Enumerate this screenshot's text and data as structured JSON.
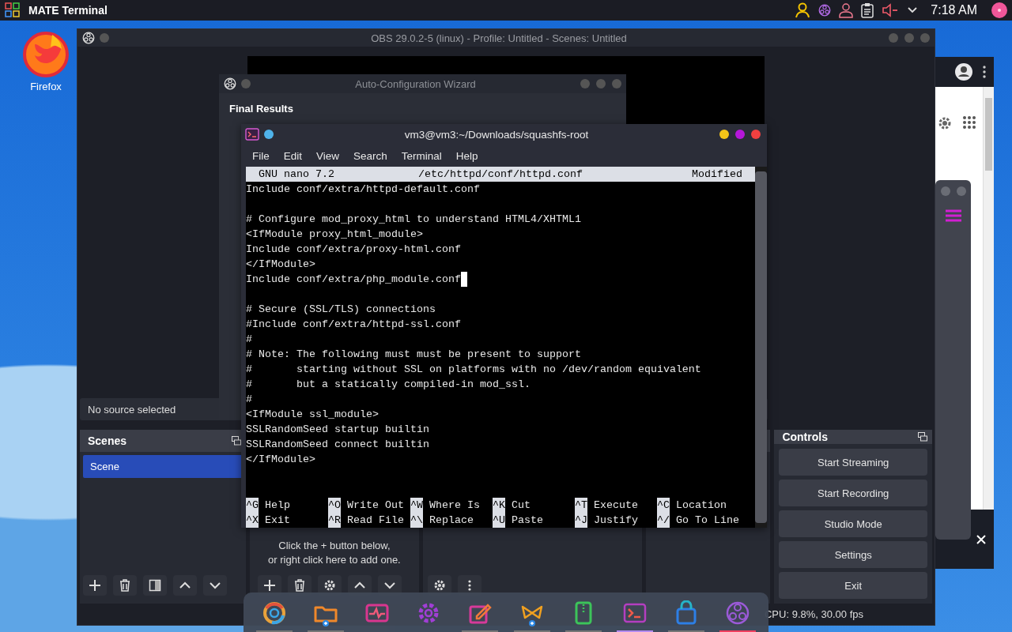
{
  "top_panel": {
    "app_title": "MATE Terminal",
    "clock": "7:18 AM"
  },
  "desktop_icons": [
    {
      "label": "Firefox"
    }
  ],
  "obs_window": {
    "title": "OBS 29.0.2-5 (linux) - Profile: Untitled - Scenes: Untitled",
    "context_bar": "No source selected",
    "scenes": {
      "title": "Scenes",
      "items": [
        {
          "label": "Scene",
          "selected": true
        }
      ]
    },
    "sources": {
      "empty_hint": [
        "Click the + button below,",
        "or right click here to add one."
      ]
    },
    "controls": {
      "title": "Controls",
      "buttons": [
        "Start Streaming",
        "Start Recording",
        "Studio Mode",
        "Settings",
        "Exit"
      ]
    },
    "status": "CPU: 9.8%, 30.00 fps"
  },
  "wizard_window": {
    "title": "Auto-Configuration Wizard",
    "heading": "Final Results"
  },
  "terminal_window": {
    "title": "vm3@vm3:~/Downloads/squashfs-root",
    "menu": [
      "File",
      "Edit",
      "View",
      "Search",
      "Terminal",
      "Help"
    ],
    "nano": {
      "version": "GNU nano 7.2",
      "file": "/etc/httpd/conf/httpd.conf",
      "status": "Modified",
      "lines": [
        {
          "kind": "text",
          "text": "Include conf/extra/httpd-default.conf",
          "cursor": false
        },
        {
          "kind": "blank"
        },
        {
          "kind": "text",
          "text": "# Configure mod_proxy_html to understand HTML4/XHTML1",
          "cursor": false
        },
        {
          "kind": "text",
          "text": "<IfModule proxy_html_module>",
          "cursor": false
        },
        {
          "kind": "text",
          "text": "Include conf/extra/proxy-html.conf",
          "cursor": false
        },
        {
          "kind": "text",
          "text": "</IfModule>",
          "cursor": false
        },
        {
          "kind": "text",
          "text": "Include conf/extra/php_module.conf",
          "cursor": true
        },
        {
          "kind": "blank"
        },
        {
          "kind": "text",
          "text": "# Secure (SSL/TLS) connections",
          "cursor": false
        },
        {
          "kind": "text",
          "text": "#Include conf/extra/httpd-ssl.conf",
          "cursor": false
        },
        {
          "kind": "text",
          "text": "#",
          "cursor": false
        },
        {
          "kind": "text",
          "text": "# Note: The following must must be present to support",
          "cursor": false
        },
        {
          "kind": "text",
          "text": "#       starting without SSL on platforms with no /dev/random equivalent",
          "cursor": false
        },
        {
          "kind": "text",
          "text": "#       but a statically compiled-in mod_ssl.",
          "cursor": false
        },
        {
          "kind": "text",
          "text": "#",
          "cursor": false
        },
        {
          "kind": "text",
          "text": "<IfModule ssl_module>",
          "cursor": false
        },
        {
          "kind": "text",
          "text": "SSLRandomSeed startup builtin",
          "cursor": false
        },
        {
          "kind": "text",
          "text": "SSLRandomSeed connect builtin",
          "cursor": false
        },
        {
          "kind": "text",
          "text": "</IfModule>",
          "cursor": false
        }
      ],
      "shortcuts": [
        [
          {
            "key": "^G",
            "label": "Help"
          },
          {
            "key": "^O",
            "label": "Write Out"
          },
          {
            "key": "^W",
            "label": "Where Is"
          },
          {
            "key": "^K",
            "label": "Cut"
          },
          {
            "key": "^T",
            "label": "Execute"
          },
          {
            "key": "^C",
            "label": "Location"
          }
        ],
        [
          {
            "key": "^X",
            "label": "Exit"
          },
          {
            "key": "^R",
            "label": "Read File"
          },
          {
            "key": "^\\",
            "label": "Replace"
          },
          {
            "key": "^U",
            "label": "Paste"
          },
          {
            "key": "^J",
            "label": "Justify"
          },
          {
            "key": "^/",
            "label": "Go To Line"
          }
        ]
      ]
    }
  }
}
